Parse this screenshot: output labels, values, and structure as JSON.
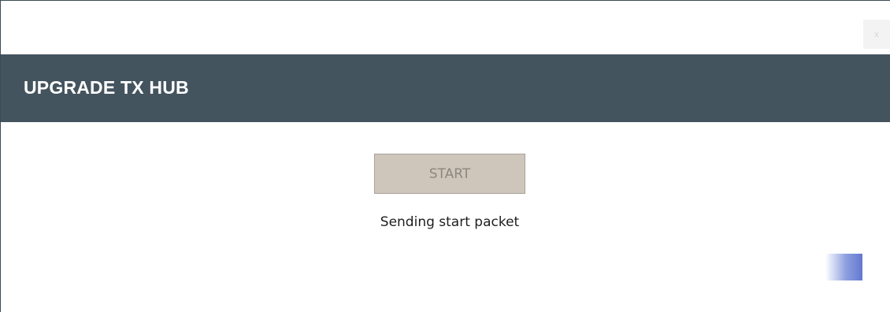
{
  "window": {
    "close_label": "x"
  },
  "header": {
    "title": "UPGRADE TX HUB",
    "background_color": "#44545f"
  },
  "main": {
    "start_button_label": "START",
    "start_button_enabled": false,
    "status_text": "Sending start packet",
    "progress": {
      "indeterminate": true,
      "accent_color": "#6377d0"
    }
  }
}
